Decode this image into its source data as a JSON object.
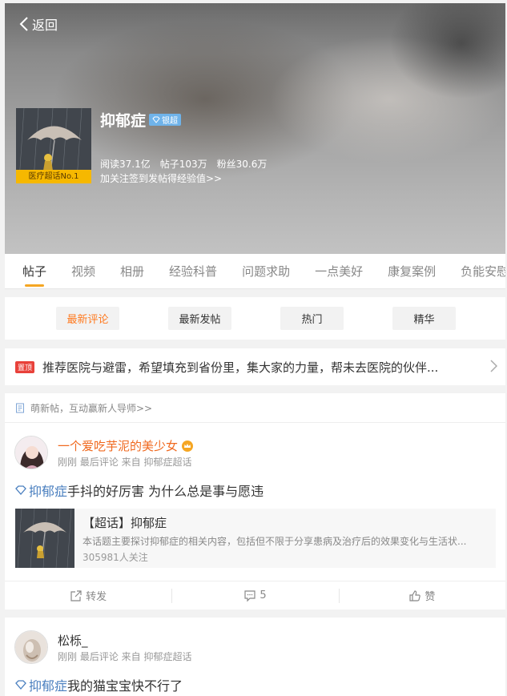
{
  "header": {
    "back_label": "返回",
    "topic_name": "抑郁症",
    "badge_label": "银超",
    "rank_label": "医疗超话No.1",
    "stats": {
      "reads": "阅读37.1亿",
      "posts": "帖子103万",
      "fans": "粉丝30.6万"
    },
    "hint": "加关注签到发帖得经验值>>"
  },
  "tabs": [
    {
      "label": "帖子",
      "active": true
    },
    {
      "label": "视频"
    },
    {
      "label": "相册"
    },
    {
      "label": "经验科普"
    },
    {
      "label": "问题求助"
    },
    {
      "label": "一点美好"
    },
    {
      "label": "康复案例"
    },
    {
      "label": "负能安慰"
    }
  ],
  "filters": [
    {
      "label": "最新评论",
      "active": true
    },
    {
      "label": "最新发帖"
    },
    {
      "label": "热门"
    },
    {
      "label": "精华"
    }
  ],
  "pinned": {
    "tag": "置顶",
    "text": "推荐医院与避雷，希望填充到省份里，集大家的力量，帮未去医院的伙伴..."
  },
  "notice": {
    "text": "萌新帖，互动赢新人导师>>"
  },
  "posts": [
    {
      "username": "一个爱吃芋泥的美少女",
      "meta": "刚刚 最后评论 来自 抑郁症超话",
      "topic": "抑郁症",
      "text": "手抖的好厉害 为什么总是事与愿违",
      "card": {
        "title": "【超话】抑郁症",
        "desc": "本话题主要探讨抑郁症的相关内容，包括但不限于分享患病及治疗后的效果变化与生活状...",
        "follow": "305981人关注"
      },
      "actions": {
        "repost": "转发",
        "comments": "5",
        "like": "赞"
      }
    },
    {
      "username": "松栎_",
      "meta": "刚刚 最后评论 来自 抑郁症超话",
      "topic": "抑郁症",
      "text": "我的猫宝宝快不行了"
    }
  ],
  "colors": {
    "accent": "#f5a623",
    "active_filter": "#ff7a20",
    "topic_link": "#4a7fbf",
    "username_highlight": "#f0691f"
  }
}
